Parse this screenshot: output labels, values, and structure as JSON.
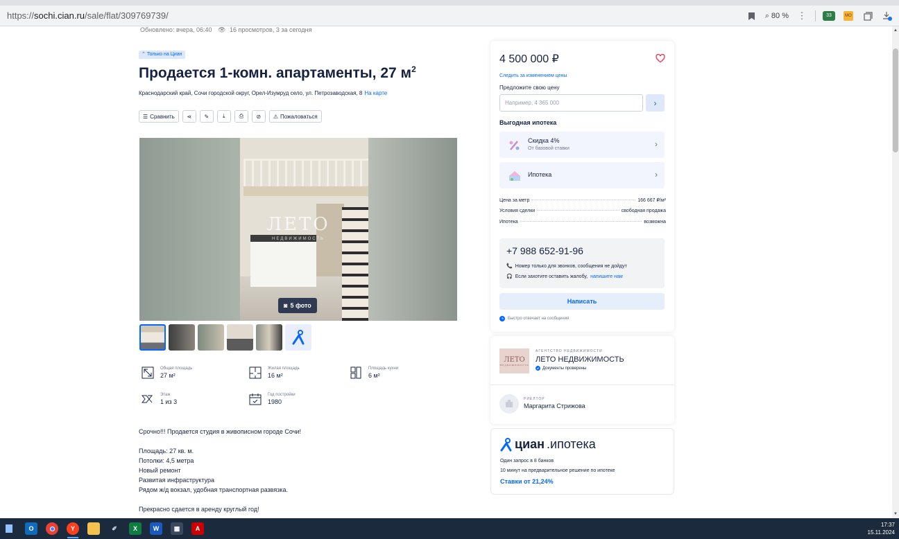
{
  "browser": {
    "url_prefix": "https://",
    "url_host": "sochi.cian.ru",
    "url_path": "/sale/flat/309769739/",
    "zoom": "80 %",
    "extension_badge": "33",
    "extension_mo": "MO"
  },
  "listing": {
    "updated": "Обновлено: вчера, 06:40",
    "views": "16 просмотров, 3 за сегодня",
    "badge": "Только на Циан",
    "title": "Продается 1-комн. апартаменты, 27 м",
    "title_sup": "2",
    "address": "Краснодарский край, Сочи городской округ, Орел-Изумруд село, ул. Петрозаводская, 8",
    "map_link": "На карте",
    "actions": {
      "compare": "Сравнить",
      "complain": "Пожаловаться"
    },
    "watermark": "ЛЕТО",
    "watermark_sub": "НЕДВИЖИМОСТЬ",
    "photo_count": "5 фото"
  },
  "params": [
    {
      "label": "Общая площадь",
      "value": "27 м²",
      "icon": "area-icon"
    },
    {
      "label": "Жилая площадь",
      "value": "16 м²",
      "icon": "living-area-icon"
    },
    {
      "label": "Площадь кухни",
      "value": "6 м²",
      "icon": "kitchen-icon"
    },
    {
      "label": "Этаж",
      "value": "1 из 3",
      "icon": "floor-icon"
    },
    {
      "label": "Год постройки",
      "value": "1980",
      "icon": "calendar-icon"
    }
  ],
  "description": {
    "lead": "Срочно!!! Продается студия в живописном городе Сочи!",
    "lines": [
      "Площадь: 27 кв. м.",
      "Потолки: 4,5 метра",
      "Новый ремонт",
      "Развитая инфраструктура",
      "Рядом ж/д вокзал, удобная транспортная развязка."
    ],
    "tail": "Прекрасно сдается в аренду круглый год!"
  },
  "price_card": {
    "price": "4 500 000 ₽",
    "follow": "Следить за изменением цены",
    "offer_label": "Предложите свою цену",
    "offer_placeholder": "Например, 4 365 000",
    "mortgage_title": "Выгодная ипотека",
    "discount_title": "Скидка 4%",
    "discount_sub": "От базовой ставки",
    "mortgage_item": "Ипотека",
    "facts": [
      {
        "label": "Цена за метр",
        "value": "166 667 ₽/м²"
      },
      {
        "label": "Условия сделки",
        "value": "свободная продажа"
      },
      {
        "label": "Ипотека",
        "value": "возможна"
      }
    ],
    "phone": "+7 988 652-91-96",
    "phone_note": "Номер только для звонков, сообщения не дойдут",
    "complaint_note": "Если захотите оставить жалобу,",
    "complaint_link": "напишите нам",
    "write_button": "Написать",
    "quick_reply": "Быстро отвечает на сообщения"
  },
  "agency": {
    "logo_text": "ЛЕТО",
    "logo_sub": "НЕДВИЖИМОСТЬ",
    "kind": "АГЕНТСТВО НЕДВИЖИМОСТИ",
    "name": "ЛЕТО НЕДВИЖИМОСТЬ",
    "verified": "Документы проверены",
    "realtor_kind": "РИЕЛТОР",
    "realtor_name": "Маргарита Стрижова"
  },
  "promo": {
    "brand": "циан",
    "brand_suffix": ".ипотека",
    "line1": "Один запрос в 8 банков",
    "line2": "10 минут на предварительное решение по ипотеке",
    "rate": "Ставки от 21,24%"
  },
  "taskbar": {
    "time": "17:37",
    "date": "15.11.2024"
  },
  "colors": {
    "accent": "#0468ff",
    "text": "#152242",
    "heart": "#e84260"
  }
}
